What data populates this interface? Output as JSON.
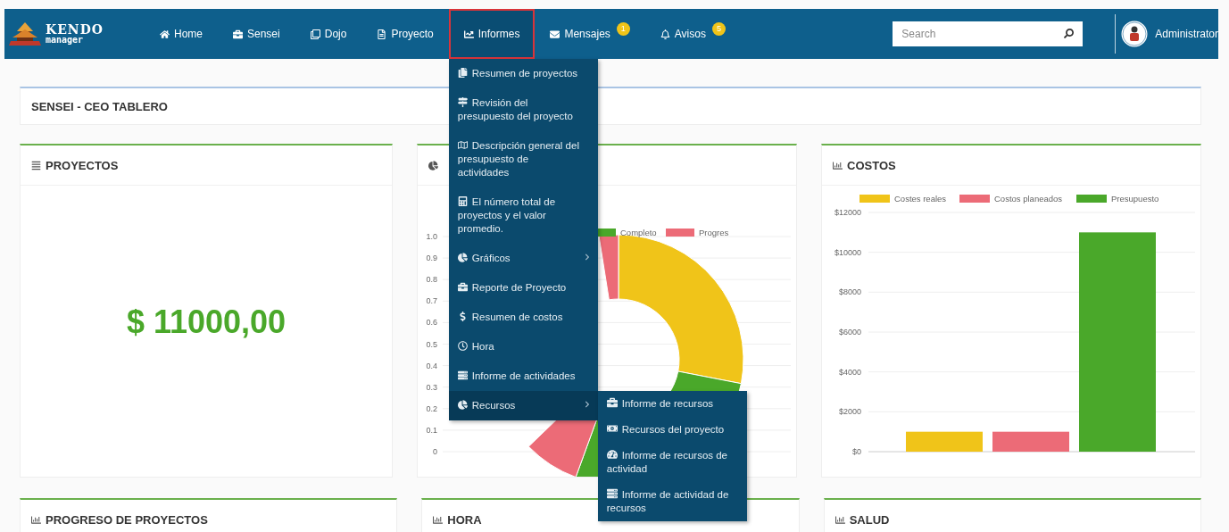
{
  "navbar": {
    "logo": {
      "title": "KENDO",
      "subtitle": "manager"
    },
    "items": [
      {
        "label": "Home",
        "selected": false
      },
      {
        "label": "Sensei",
        "selected": false
      },
      {
        "label": "Dojo",
        "selected": false
      },
      {
        "label": "Proyecto",
        "selected": false
      },
      {
        "label": "Informes",
        "selected": true
      },
      {
        "label": "Mensajes",
        "selected": false,
        "badge": "1"
      },
      {
        "label": "Avisos",
        "selected": false,
        "badge": "5"
      }
    ],
    "search": {
      "placeholder": "Search"
    },
    "user": {
      "name": "Administrator"
    }
  },
  "page_header": {
    "title": "SENSEI - CEO TABLERO"
  },
  "cards": [
    {
      "kind": "amount",
      "title": "PROYECTOS",
      "amount": "$ 11000,00"
    },
    {
      "kind": "donut",
      "y_axis_labels": [
        "1.0",
        "0.9",
        "0.8",
        "0.7",
        "0.6",
        "0.5",
        "0.4",
        "0.3",
        "0.2",
        "0.1",
        "0"
      ],
      "legend": [
        {
          "label": "Completo",
          "color": "#4aa82a"
        },
        {
          "label": "Progres",
          "color": "#ec6b77"
        }
      ]
    },
    {
      "kind": "bars",
      "title": "COSTOS",
      "chart_data": {
        "type": "bar",
        "grid": true,
        "legend": true,
        "ylim": [
          0,
          12000
        ],
        "yticks": [
          {
            "value": 0,
            "label": "$0"
          },
          {
            "value": 2000,
            "label": "$2000"
          },
          {
            "value": 4000,
            "label": "$4000"
          },
          {
            "value": 6000,
            "label": "$6000"
          },
          {
            "value": 8000,
            "label": "$8000"
          },
          {
            "value": 10000,
            "label": "$10000"
          },
          {
            "value": 12000,
            "label": "$12000"
          }
        ],
        "series": [
          {
            "name": "Costes reales",
            "color": "#f0c419",
            "values": [
              1000
            ]
          },
          {
            "name": "Costos planeados",
            "color": "#ec6b77",
            "values": [
              1000
            ]
          },
          {
            "name": "Presupuesto",
            "color": "#4aa82a",
            "values": [
              11000
            ]
          }
        ]
      }
    }
  ],
  "bottom_cards": [
    {
      "title": "PROGRESO DE PROYECTOS"
    },
    {
      "title": "HORA"
    },
    {
      "title": "SALUD"
    }
  ],
  "reports_menu": {
    "items": [
      {
        "label": "Resumen de proyectos",
        "selected": false,
        "has_submenu": false
      },
      {
        "label": "Revisión del presupuesto del proyecto",
        "selected": false,
        "has_submenu": false
      },
      {
        "label": "Descripción general del presupuesto de actividades",
        "selected": false,
        "has_submenu": false
      },
      {
        "label": "El número total de proyectos y el valor promedio.",
        "selected": false,
        "has_submenu": false
      },
      {
        "label": "Gráficos",
        "selected": false,
        "has_submenu": true
      },
      {
        "label": "Reporte de Proyecto",
        "selected": false,
        "has_submenu": false
      },
      {
        "label": "Resumen de costos",
        "selected": false,
        "has_submenu": false
      },
      {
        "label": "Hora",
        "selected": false,
        "has_submenu": false
      },
      {
        "label": "Informe de actividades",
        "selected": false,
        "has_submenu": false
      },
      {
        "label": "Recursos",
        "selected": true,
        "has_submenu": true
      }
    ],
    "submenu": [
      {
        "label": "Informe de recursos"
      },
      {
        "label": "Recursos del proyecto"
      },
      {
        "label": "Informe de recursos de actividad"
      },
      {
        "label": "Informe de actividad de recursos"
      }
    ]
  }
}
